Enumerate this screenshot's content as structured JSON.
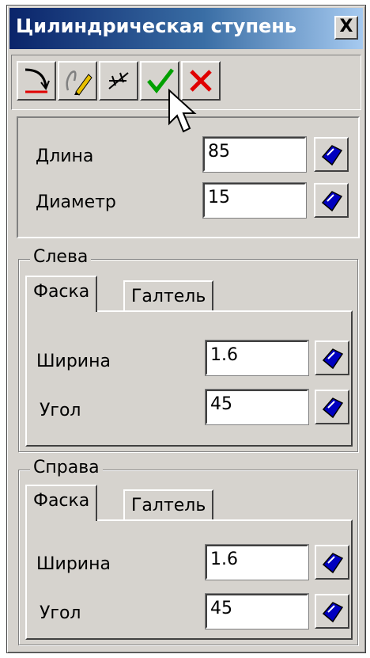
{
  "window": {
    "title": "Цилиндрическая ступень",
    "close_label": "X"
  },
  "toolbar": {
    "buttons": [
      {
        "icon": "curve-tool-icon"
      },
      {
        "icon": "edit-pencil-icon"
      },
      {
        "icon": "point-tool-icon"
      },
      {
        "icon": "checkmark-icon",
        "color": "#00a000"
      },
      {
        "icon": "cross-icon",
        "color": "#e00000"
      }
    ]
  },
  "main": {
    "length": {
      "label": "Длина",
      "value": "85"
    },
    "diameter": {
      "label": "Диаметр",
      "value": "15"
    }
  },
  "left": {
    "title": "Слева",
    "tabs": [
      "Фаска",
      "Галтель"
    ],
    "active_tab": "Фаска",
    "width": {
      "label": "Ширина",
      "value": "1.6"
    },
    "angle": {
      "label": "Угол",
      "value": "45"
    }
  },
  "right": {
    "title": "Справа",
    "tabs": [
      "Фаска",
      "Галтель"
    ],
    "active_tab": "Фаска",
    "width": {
      "label": "Ширина",
      "value": "1.6"
    },
    "angle": {
      "label": "Угол",
      "value": "45"
    }
  },
  "colors": {
    "title_bar": "#0a246a",
    "face": "#d6d3ce",
    "picker_icon": "#0000c0"
  }
}
